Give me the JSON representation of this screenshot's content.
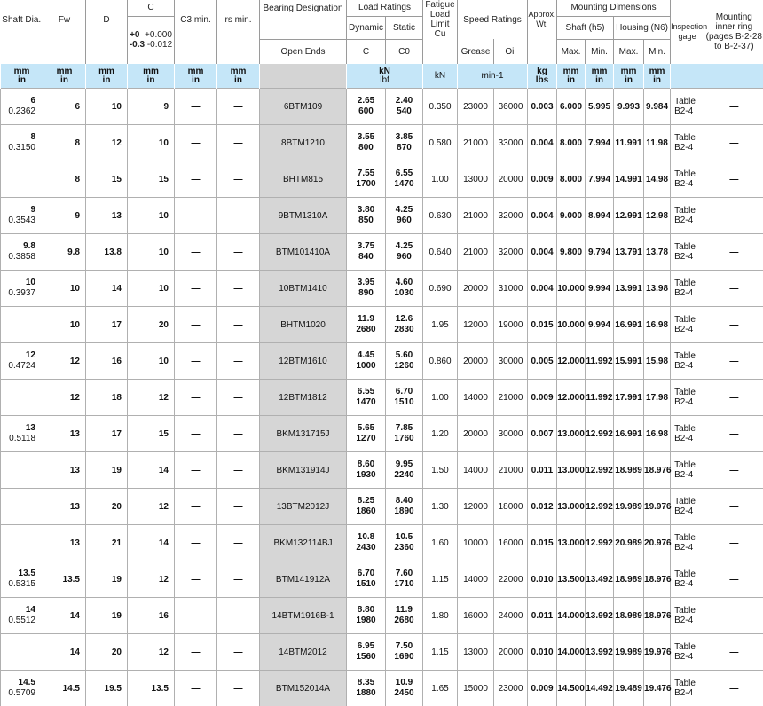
{
  "headers": {
    "shaft": "Shaft Dia.",
    "fw": "Fw",
    "d": "D",
    "c": "C",
    "c_tol": [
      "+0",
      "+0.000",
      "-0.3",
      "-0.012"
    ],
    "c3": "C3 min.",
    "rs": "rs min.",
    "designation": "Bearing Designation",
    "open_ends": "Open Ends",
    "load_ratings": "Load Ratings",
    "dynamic": "Dynamic",
    "static": "Static",
    "dyn_c": "C",
    "stat_c": "C0",
    "fatigue": [
      "Fatigue",
      "Load",
      "Limit",
      "Cu"
    ],
    "speed": "Speed Ratings",
    "grease": "Grease",
    "oil": "Oil",
    "wt": [
      "Approx.",
      "Wt."
    ],
    "mounting": "Mounting Dimensions",
    "shaft_h5": "Shaft (h5)",
    "housing_n6": "Housing (N6)",
    "max": "Max.",
    "min": "Min.",
    "inspection": [
      "Inspection",
      "gage"
    ],
    "ring": [
      "Mounting",
      "inner ring",
      "(pages B-2-28",
      "to B-2-37)"
    ]
  },
  "units": {
    "mm": "mm",
    "in": "in",
    "kn": "kN",
    "lbf": "lbf",
    "speed": "min-1",
    "kg": "kg",
    "lbs": "lbs"
  },
  "rows": [
    {
      "shaft_mm": "6",
      "shaft_in": "0.2362",
      "fw": "6",
      "d": "10",
      "c": "9",
      "c3": "—",
      "rs": "—",
      "designation": "6BTM109",
      "dyn_kn": "2.65",
      "dyn_lbf": "600",
      "stat_kn": "2.40",
      "stat_lbf": "540",
      "cu": "0.350",
      "grease": "23000",
      "oil": "36000",
      "wt": "0.003",
      "s_max": "6.000",
      "s_min": "5.995",
      "h_max": "9.993",
      "h_min": "9.984",
      "insp1": "Table",
      "insp2": "B2-4",
      "ring": "—"
    },
    {
      "shaft_mm": "8",
      "shaft_in": "0.3150",
      "fw": "8",
      "d": "12",
      "c": "10",
      "c3": "—",
      "rs": "—",
      "designation": "8BTM1210",
      "dyn_kn": "3.55",
      "dyn_lbf": "800",
      "stat_kn": "3.85",
      "stat_lbf": "870",
      "cu": "0.580",
      "grease": "21000",
      "oil": "33000",
      "wt": "0.004",
      "s_max": "8.000",
      "s_min": "7.994",
      "h_max": "11.991",
      "h_min": "11.98",
      "insp1": "Table",
      "insp2": "B2-4",
      "ring": "—"
    },
    {
      "shaft_mm": "",
      "shaft_in": "",
      "fw": "8",
      "d": "15",
      "c": "15",
      "c3": "—",
      "rs": "—",
      "designation": "BHTM815",
      "dyn_kn": "7.55",
      "dyn_lbf": "1700",
      "stat_kn": "6.55",
      "stat_lbf": "1470",
      "cu": "1.00",
      "grease": "13000",
      "oil": "20000",
      "wt": "0.009",
      "s_max": "8.000",
      "s_min": "7.994",
      "h_max": "14.991",
      "h_min": "14.98",
      "insp1": "Table",
      "insp2": "B2-4",
      "ring": "—"
    },
    {
      "shaft_mm": "9",
      "shaft_in": "0.3543",
      "fw": "9",
      "d": "13",
      "c": "10",
      "c3": "—",
      "rs": "—",
      "designation": "9BTM1310A",
      "dyn_kn": "3.80",
      "dyn_lbf": "850",
      "stat_kn": "4.25",
      "stat_lbf": "960",
      "cu": "0.630",
      "grease": "21000",
      "oil": "32000",
      "wt": "0.004",
      "s_max": "9.000",
      "s_min": "8.994",
      "h_max": "12.991",
      "h_min": "12.98",
      "insp1": "Table",
      "insp2": "B2-4",
      "ring": "—"
    },
    {
      "shaft_mm": "9.8",
      "shaft_in": "0.3858",
      "fw": "9.8",
      "d": "13.8",
      "c": "10",
      "c3": "—",
      "rs": "—",
      "designation": "BTM101410A",
      "dyn_kn": "3.75",
      "dyn_lbf": "840",
      "stat_kn": "4.25",
      "stat_lbf": "960",
      "cu": "0.640",
      "grease": "21000",
      "oil": "32000",
      "wt": "0.004",
      "s_max": "9.800",
      "s_min": "9.794",
      "h_max": "13.791",
      "h_min": "13.78",
      "insp1": "Table",
      "insp2": "B2-4",
      "ring": "—"
    },
    {
      "shaft_mm": "10",
      "shaft_in": "0.3937",
      "fw": "10",
      "d": "14",
      "c": "10",
      "c3": "—",
      "rs": "—",
      "designation": "10BTM1410",
      "dyn_kn": "3.95",
      "dyn_lbf": "890",
      "stat_kn": "4.60",
      "stat_lbf": "1030",
      "cu": "0.690",
      "grease": "20000",
      "oil": "31000",
      "wt": "0.004",
      "s_max": "10.000",
      "s_min": "9.994",
      "h_max": "13.991",
      "h_min": "13.98",
      "insp1": "Table",
      "insp2": "B2-4",
      "ring": "—"
    },
    {
      "shaft_mm": "",
      "shaft_in": "",
      "fw": "10",
      "d": "17",
      "c": "20",
      "c3": "—",
      "rs": "—",
      "designation": "BHTM1020",
      "dyn_kn": "11.9",
      "dyn_lbf": "2680",
      "stat_kn": "12.6",
      "stat_lbf": "2830",
      "cu": "1.95",
      "grease": "12000",
      "oil": "19000",
      "wt": "0.015",
      "s_max": "10.000",
      "s_min": "9.994",
      "h_max": "16.991",
      "h_min": "16.98",
      "insp1": "Table",
      "insp2": "B2-4",
      "ring": "—"
    },
    {
      "shaft_mm": "12",
      "shaft_in": "0.4724",
      "fw": "12",
      "d": "16",
      "c": "10",
      "c3": "—",
      "rs": "—",
      "designation": "12BTM1610",
      "dyn_kn": "4.45",
      "dyn_lbf": "1000",
      "stat_kn": "5.60",
      "stat_lbf": "1260",
      "cu": "0.860",
      "grease": "20000",
      "oil": "30000",
      "wt": "0.005",
      "s_max": "12.000",
      "s_min": "11.992",
      "h_max": "15.991",
      "h_min": "15.98",
      "insp1": "Table",
      "insp2": "B2-4",
      "ring": "—"
    },
    {
      "shaft_mm": "",
      "shaft_in": "",
      "fw": "12",
      "d": "18",
      "c": "12",
      "c3": "—",
      "rs": "—",
      "designation": "12BTM1812",
      "dyn_kn": "6.55",
      "dyn_lbf": "1470",
      "stat_kn": "6.70",
      "stat_lbf": "1510",
      "cu": "1.00",
      "grease": "14000",
      "oil": "21000",
      "wt": "0.009",
      "s_max": "12.000",
      "s_min": "11.992",
      "h_max": "17.991",
      "h_min": "17.98",
      "insp1": "Table",
      "insp2": "B2-4",
      "ring": "—"
    },
    {
      "shaft_mm": "13",
      "shaft_in": "0.5118",
      "fw": "13",
      "d": "17",
      "c": "15",
      "c3": "—",
      "rs": "—",
      "designation": "BKM131715J",
      "dyn_kn": "5.65",
      "dyn_lbf": "1270",
      "stat_kn": "7.85",
      "stat_lbf": "1760",
      "cu": "1.20",
      "grease": "20000",
      "oil": "30000",
      "wt": "0.007",
      "s_max": "13.000",
      "s_min": "12.992",
      "h_max": "16.991",
      "h_min": "16.98",
      "insp1": "Table",
      "insp2": "B2-4",
      "ring": "—"
    },
    {
      "shaft_mm": "",
      "shaft_in": "",
      "fw": "13",
      "d": "19",
      "c": "14",
      "c3": "—",
      "rs": "—",
      "designation": "BKM131914J",
      "dyn_kn": "8.60",
      "dyn_lbf": "1930",
      "stat_kn": "9.95",
      "stat_lbf": "2240",
      "cu": "1.50",
      "grease": "14000",
      "oil": "21000",
      "wt": "0.011",
      "s_max": "13.000",
      "s_min": "12.992",
      "h_max": "18.989",
      "h_min": "18.976",
      "insp1": "Table",
      "insp2": "B2-4",
      "ring": "—"
    },
    {
      "shaft_mm": "",
      "shaft_in": "",
      "fw": "13",
      "d": "20",
      "c": "12",
      "c3": "—",
      "rs": "—",
      "designation": "13BTM2012J",
      "dyn_kn": "8.25",
      "dyn_lbf": "1860",
      "stat_kn": "8.40",
      "stat_lbf": "1890",
      "cu": "1.30",
      "grease": "12000",
      "oil": "18000",
      "wt": "0.012",
      "s_max": "13.000",
      "s_min": "12.992",
      "h_max": "19.989",
      "h_min": "19.976",
      "insp1": "Table",
      "insp2": "B2-4",
      "ring": "—"
    },
    {
      "shaft_mm": "",
      "shaft_in": "",
      "fw": "13",
      "d": "21",
      "c": "14",
      "c3": "—",
      "rs": "—",
      "designation": "BKM132114BJ",
      "dyn_kn": "10.8",
      "dyn_lbf": "2430",
      "stat_kn": "10.5",
      "stat_lbf": "2360",
      "cu": "1.60",
      "grease": "10000",
      "oil": "16000",
      "wt": "0.015",
      "s_max": "13.000",
      "s_min": "12.992",
      "h_max": "20.989",
      "h_min": "20.976",
      "insp1": "Table",
      "insp2": "B2-4",
      "ring": "—"
    },
    {
      "shaft_mm": "13.5",
      "shaft_in": "0.5315",
      "fw": "13.5",
      "d": "19",
      "c": "12",
      "c3": "—",
      "rs": "—",
      "designation": "BTM141912A",
      "dyn_kn": "6.70",
      "dyn_lbf": "1510",
      "stat_kn": "7.60",
      "stat_lbf": "1710",
      "cu": "1.15",
      "grease": "14000",
      "oil": "22000",
      "wt": "0.010",
      "s_max": "13.500",
      "s_min": "13.492",
      "h_max": "18.989",
      "h_min": "18.976",
      "insp1": "Table",
      "insp2": "B2-4",
      "ring": "—"
    },
    {
      "shaft_mm": "14",
      "shaft_in": "0.5512",
      "fw": "14",
      "d": "19",
      "c": "16",
      "c3": "—",
      "rs": "—",
      "designation": "14BTM1916B-1",
      "dyn_kn": "8.80",
      "dyn_lbf": "1980",
      "stat_kn": "11.9",
      "stat_lbf": "2680",
      "cu": "1.80",
      "grease": "16000",
      "oil": "24000",
      "wt": "0.011",
      "s_max": "14.000",
      "s_min": "13.992",
      "h_max": "18.989",
      "h_min": "18.976",
      "insp1": "Table",
      "insp2": "B2-4",
      "ring": "—"
    },
    {
      "shaft_mm": "",
      "shaft_in": "",
      "fw": "14",
      "d": "20",
      "c": "12",
      "c3": "—",
      "rs": "—",
      "designation": "14BTM2012",
      "dyn_kn": "6.95",
      "dyn_lbf": "1560",
      "stat_kn": "7.50",
      "stat_lbf": "1690",
      "cu": "1.15",
      "grease": "13000",
      "oil": "20000",
      "wt": "0.010",
      "s_max": "14.000",
      "s_min": "13.992",
      "h_max": "19.989",
      "h_min": "19.976",
      "insp1": "Table",
      "insp2": "B2-4",
      "ring": "—"
    },
    {
      "shaft_mm": "14.5",
      "shaft_in": "0.5709",
      "fw": "14.5",
      "d": "19.5",
      "c": "13.5",
      "c3": "—",
      "rs": "—",
      "designation": "BTM152014A",
      "dyn_kn": "8.35",
      "dyn_lbf": "1880",
      "stat_kn": "10.9",
      "stat_lbf": "2450",
      "cu": "1.65",
      "grease": "15000",
      "oil": "23000",
      "wt": "0.009",
      "s_max": "14.500",
      "s_min": "14.492",
      "h_max": "19.489",
      "h_min": "19.476",
      "insp1": "Table",
      "insp2": "B2-4",
      "ring": "—"
    }
  ]
}
